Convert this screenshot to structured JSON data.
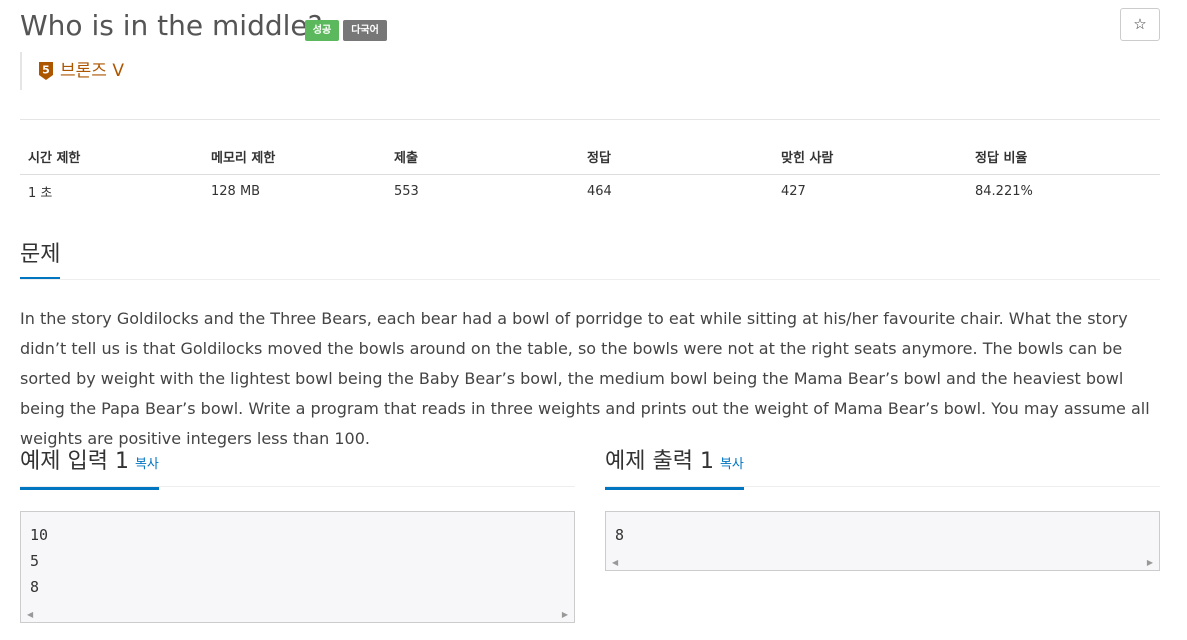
{
  "problem": {
    "title": "Who is in the middle?",
    "badges": {
      "success": "성공",
      "language": "다국어"
    },
    "star_icon": "star-outline-icon",
    "tier": {
      "number": "5",
      "label": "브론즈 V",
      "color": "#ad5600"
    }
  },
  "stats": {
    "headers": [
      "시간 제한",
      "메모리 제한",
      "제출",
      "정답",
      "맞힌 사람",
      "정답 비율"
    ],
    "values": [
      "1 초",
      "128 MB",
      "553",
      "464",
      "427",
      "84.221%"
    ]
  },
  "description": {
    "heading": "문제",
    "text": "In the story Goldilocks and the Three Bears, each bear had a bowl of porridge to eat while sitting at his/her favourite chair. What the story didn’t tell us is that Goldilocks moved the bowls around on the table, so the bowls were not at the right seats anymore. The bowls can be sorted by weight with the lightest bowl being the Baby Bear’s bowl, the medium bowl being the Mama Bear’s bowl and the heaviest bowl being the Papa Bear’s bowl. Write a program that reads in three weights and prints out the weight of Mama Bear’s bowl. You may assume all weights are positive integers less than 100."
  },
  "sample_input": {
    "heading": "예제 입력 1",
    "copy_label": "복사",
    "content": "10\n5\n8"
  },
  "sample_output": {
    "heading": "예제 출력 1",
    "copy_label": "복사",
    "content": "8"
  },
  "colors": {
    "accent": "#0076c0",
    "success": "#5cb85c",
    "badge_gray": "#777777",
    "bronze": "#ad5600"
  }
}
